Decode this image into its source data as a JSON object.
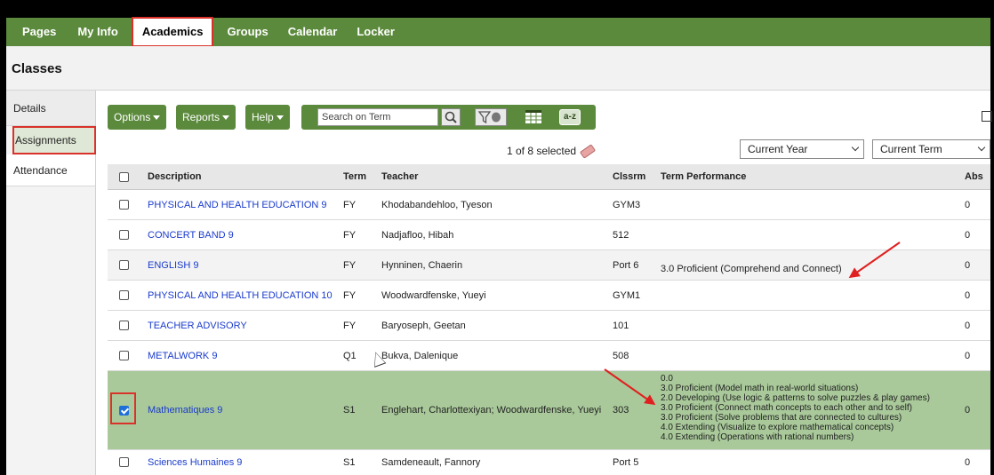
{
  "nav": {
    "items": [
      "Pages",
      "My Info",
      "Academics",
      "Groups",
      "Calendar",
      "Locker"
    ],
    "active": "Academics"
  },
  "page_title": "Classes",
  "sidebar": {
    "items": [
      "Details",
      "Assignments",
      "Attendance"
    ],
    "active": "Assignments"
  },
  "toolbar": {
    "options_label": "Options",
    "reports_label": "Reports",
    "help_label": "Help",
    "search_placeholder": "Search on Term",
    "az_label": "a-z"
  },
  "selection": {
    "count_text": "1 of 8 selected"
  },
  "filters": {
    "year": "Current Year",
    "term": "Current Term"
  },
  "table": {
    "headers": {
      "description": "Description",
      "term": "Term",
      "teacher": "Teacher",
      "clssrm": "Clssrm",
      "performance": "Term Performance",
      "abs": "Abs"
    },
    "rows": [
      {
        "description": "PHYSICAL AND HEALTH EDUCATION 9",
        "term": "FY",
        "teacher": "Khodabandehloo, Tyeson",
        "clssrm": "GYM3",
        "performance": "",
        "abs": "0"
      },
      {
        "description": "CONCERT BAND 9",
        "term": "FY",
        "teacher": "Nadjafloo, Hibah",
        "clssrm": "512",
        "performance": "",
        "abs": "0"
      },
      {
        "description": "ENGLISH 9",
        "term": "FY",
        "teacher": "Hynninen, Chaerin",
        "clssrm": "Port 6",
        "performance": "3.0 Proficient (Comprehend and Connect)",
        "abs": "0"
      },
      {
        "description": "PHYSICAL AND HEALTH EDUCATION 10",
        "term": "FY",
        "teacher": "Woodwardfenske, Yueyi",
        "clssrm": "GYM1",
        "performance": "",
        "abs": "0"
      },
      {
        "description": "TEACHER ADVISORY",
        "term": "FY",
        "teacher": "Baryoseph, Geetan",
        "clssrm": "101",
        "performance": "",
        "abs": "0"
      },
      {
        "description": "METALWORK 9",
        "term": "Q1",
        "teacher": "Bukva, Dalenique",
        "clssrm": "508",
        "performance": "",
        "abs": "0"
      },
      {
        "description": "Mathematiques 9",
        "term": "S1",
        "teacher": "Englehart, Charlottexiyan; Woodwardfenske, Yueyi",
        "clssrm": "303",
        "performance_lines": [
          "0.0",
          "3.0 Proficient (Model math in real-world situations)",
          "2.0 Developing (Use logic & patterns to solve puzzles & play games)",
          "3.0 Proficient (Connect math concepts to each other and to self)",
          "3.0 Proficient (Solve problems that are connected to cultures)",
          "4.0 Extending (Visualize to explore mathematical concepts)",
          "4.0 Extending (Operations with rational numbers)"
        ],
        "abs": "0",
        "selected": true
      },
      {
        "description": "Sciences Humaines 9",
        "term": "S1",
        "teacher": "Samdeneault, Fannory",
        "clssrm": "Port 5",
        "performance": "",
        "abs": "0"
      }
    ]
  },
  "colors": {
    "nav_green": "#5b8a3c",
    "selected_row": "#a9c99a",
    "highlight_red": "#d9322b",
    "link_blue": "#1a3bcc"
  },
  "icons": [
    "search-icon",
    "filter-icon",
    "grid-icon",
    "eraser-icon",
    "export-icon",
    "chevron-down-icon",
    "checkbox-icon"
  ]
}
